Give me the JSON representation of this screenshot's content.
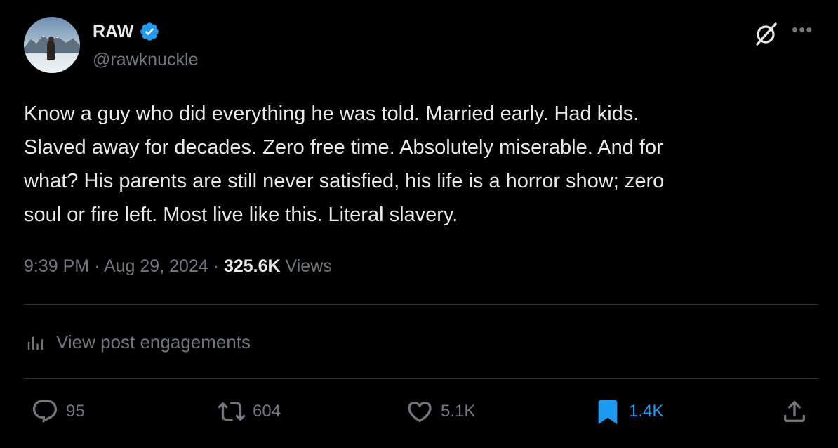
{
  "author": {
    "display_name": "RAW",
    "handle": "@rawknuckle",
    "verified": true
  },
  "post": {
    "text": "Know a guy who did everything he was told. Married early. Had kids.\nSlaved away for decades. Zero free time. Absolutely miserable. And for\nwhat? His parents are still never satisfied, his life is a horror show; zero\nsoul or fire left. Most live like this. Literal slavery.",
    "time": "9:39 PM",
    "date": "Aug 29, 2024",
    "separator": "·",
    "views_count": "325.6K",
    "views_label": "Views"
  },
  "engagements_link": "View post engagements",
  "actions": {
    "replies": "95",
    "reposts": "604",
    "likes": "5.1K",
    "bookmarks": "1.4K"
  },
  "colors": {
    "background": "#000000",
    "text": "#e7e9ea",
    "muted": "#71767b",
    "accent": "#1d9bf0",
    "divider": "#2f3336"
  },
  "icons": [
    "verified-badge-icon",
    "grok-icon",
    "more-icon",
    "analytics-icon",
    "reply-icon",
    "repost-icon",
    "like-icon",
    "bookmark-icon",
    "share-icon"
  ]
}
